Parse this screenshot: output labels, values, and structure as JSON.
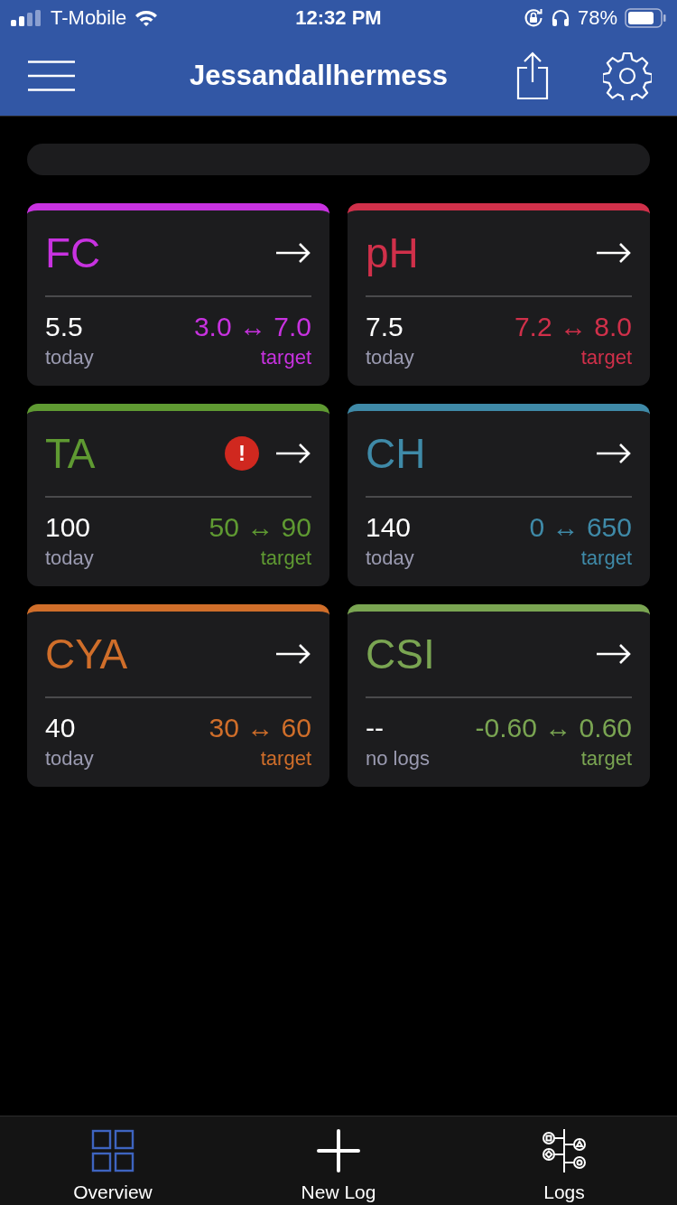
{
  "status_bar": {
    "carrier": "T-Mobile",
    "time": "12:32 PM",
    "battery": "78%"
  },
  "header": {
    "title": "Jessandallhermess"
  },
  "cards": [
    {
      "name": "FC",
      "color": "#c832e0",
      "value": "5.5",
      "value_label": "today",
      "range": "3.0 ↔ 7.0",
      "range_label": "target"
    },
    {
      "name": "pH",
      "color": "#d0304a",
      "value": "7.5",
      "value_label": "today",
      "range": "7.2 ↔ 8.0",
      "range_label": "target"
    },
    {
      "name": "TA",
      "color": "#5f9a32",
      "alert": "!",
      "value": "100",
      "value_label": "today",
      "range": "50 ↔ 90",
      "range_label": "target"
    },
    {
      "name": "CH",
      "color": "#3f8aa8",
      "value": "140",
      "value_label": "today",
      "range": "0 ↔ 650",
      "range_label": "target"
    },
    {
      "name": "CYA",
      "color": "#d06e2a",
      "value": "40",
      "value_label": "today",
      "range": "30 ↔ 60",
      "range_label": "target"
    },
    {
      "name": "CSI",
      "color": "#7aa552",
      "value": "--",
      "value_label": "no logs",
      "range": "-0.60 ↔ 0.60",
      "range_label": "target"
    }
  ],
  "tab_bar": [
    {
      "label": "Overview",
      "kind": "overview",
      "selected": true
    },
    {
      "label": "New Log",
      "kind": "new",
      "selected": false
    },
    {
      "label": "Logs",
      "kind": "logs",
      "selected": false
    }
  ]
}
